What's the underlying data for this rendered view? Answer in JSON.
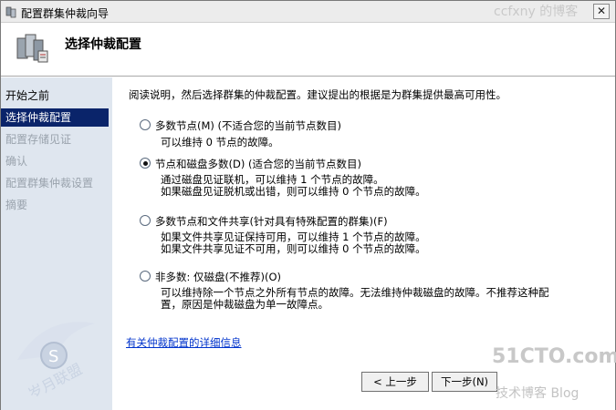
{
  "window": {
    "title": "配置群集仲裁向导",
    "close_glyph": "✕",
    "watermark": "ccfxny 的博客"
  },
  "header": {
    "title": "选择仲裁配置"
  },
  "nav": {
    "items": [
      {
        "label": "开始之前",
        "state": "normal"
      },
      {
        "label": "选择仲裁配置",
        "state": "active"
      },
      {
        "label": "配置存储见证",
        "state": "disabled"
      },
      {
        "label": "确认",
        "state": "disabled"
      },
      {
        "label": "配置群集仲裁设置",
        "state": "disabled"
      },
      {
        "label": "摘要",
        "state": "disabled"
      }
    ]
  },
  "content": {
    "intro": "阅读说明，然后选择群集的仲裁配置。建议提出的根据是为群集提供最高可用性。",
    "options": [
      {
        "label": "多数节点(M) (不适合您的当前节点数目)",
        "checked": false,
        "desc": [
          "可以维持 0 节点的故障。"
        ]
      },
      {
        "label": "节点和磁盘多数(D) (适合您的当前节点数目)",
        "checked": true,
        "desc": [
          "通过磁盘见证联机，可以维持 1 个节点的故障。",
          "如果磁盘见证脱机或出错，则可以维持 0 个节点的故障。"
        ]
      },
      {
        "label": "多数节点和文件共享(针对具有特殊配置的群集)(F)",
        "checked": false,
        "desc": [
          "如果文件共享见证保持可用，可以维持 1 个节点的故障。",
          "如果文件共享见证不可用，则可以维持 0 个节点的故障。"
        ]
      },
      {
        "label": "非多数: 仅磁盘(不推荐)(O)",
        "checked": false,
        "desc": [
          "可以维持除一个节点之外所有节点的故障。无法维持仲裁磁盘的故障。不推荐这种配",
          "置，原因是仲裁磁盘为单一故障点。"
        ]
      }
    ],
    "link": "有关仲裁配置的详细信息"
  },
  "buttons": {
    "prev": "< 上一步",
    "next": "下一步(N)"
  },
  "watermarks": {
    "brand": "51CTO.com",
    "brand_sub": "技术博客  Blog",
    "left_logo": "岁月联盟"
  },
  "colors": {
    "nav_bg": "#dfe6ef",
    "nav_active": "#0a246a",
    "link": "#0033cc"
  }
}
